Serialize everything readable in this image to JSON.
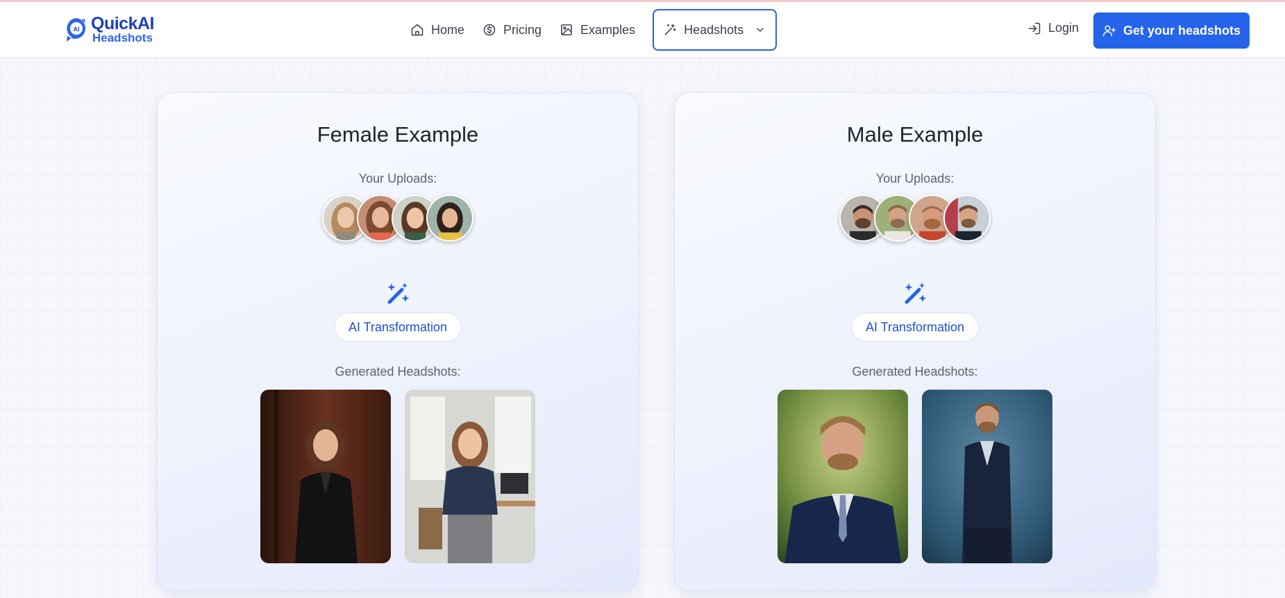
{
  "brand": {
    "title": "QuickAI",
    "subtitle": "Headshots",
    "mark": "AI"
  },
  "nav": {
    "items": [
      {
        "label": "Home",
        "icon": "home-icon"
      },
      {
        "label": "Pricing",
        "icon": "dollar-circle-icon"
      },
      {
        "label": "Examples",
        "icon": "image-icon"
      },
      {
        "label": "Headshots",
        "icon": "magic-wand-icon",
        "active": true
      }
    ],
    "login": "Login",
    "cta": "Get your headshots"
  },
  "cards": [
    {
      "title": "Female Example",
      "uploads_label": "Your Uploads:",
      "transform_label": "AI Transformation",
      "generated_label": "Generated Headshots:"
    },
    {
      "title": "Male Example",
      "uploads_label": "Your Uploads:",
      "transform_label": "AI Transformation",
      "generated_label": "Generated Headshots:"
    }
  ],
  "colors": {
    "accent": "#2563eb",
    "brand_dark": "#1e3fbf",
    "text": "#1f2430",
    "muted": "#5b6170"
  }
}
